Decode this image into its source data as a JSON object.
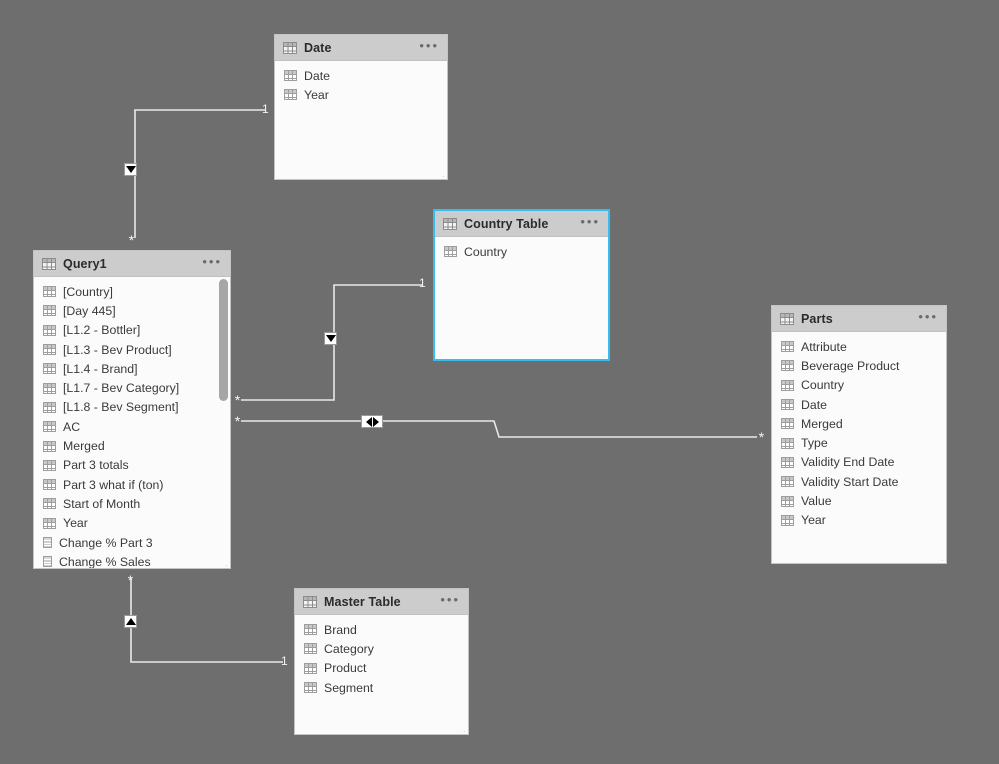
{
  "canvas": {
    "background_color": "#6e6e6e",
    "view_name": "Model view relationships diagram"
  },
  "tables": [
    {
      "id": "date",
      "name": "Date",
      "selected": false,
      "menu_label": "•••",
      "fields": [
        {
          "label": "Date",
          "icon": "table-column-icon",
          "kind": "column"
        },
        {
          "label": "Year",
          "icon": "table-column-icon",
          "kind": "column"
        }
      ]
    },
    {
      "id": "country-table",
      "name": "Country Table",
      "selected": true,
      "menu_label": "•••",
      "fields": [
        {
          "label": "Country",
          "icon": "table-column-icon",
          "kind": "column"
        }
      ]
    },
    {
      "id": "query1",
      "name": "Query1",
      "selected": false,
      "menu_label": "•••",
      "fields": [
        {
          "label": "[Country]",
          "icon": "table-column-icon",
          "kind": "column"
        },
        {
          "label": "[Day 445]",
          "icon": "table-column-icon",
          "kind": "column"
        },
        {
          "label": "[L1.2 - Bottler]",
          "icon": "table-column-icon",
          "kind": "column"
        },
        {
          "label": "[L1.3 - Bev Product]",
          "icon": "table-column-icon",
          "kind": "column"
        },
        {
          "label": "[L1.4 - Brand]",
          "icon": "table-column-icon",
          "kind": "column"
        },
        {
          "label": "[L1.7 - Bev Category]",
          "icon": "table-column-icon",
          "kind": "column"
        },
        {
          "label": "[L1.8 - Bev Segment]",
          "icon": "table-column-icon",
          "kind": "column"
        },
        {
          "label": "AC",
          "icon": "table-column-icon",
          "kind": "column"
        },
        {
          "label": "Merged",
          "icon": "table-column-icon",
          "kind": "column"
        },
        {
          "label": "Part 3 totals",
          "icon": "table-column-icon",
          "kind": "column"
        },
        {
          "label": "Part 3 what if (ton)",
          "icon": "table-column-icon",
          "kind": "column"
        },
        {
          "label": "Start of Month",
          "icon": "table-column-icon",
          "kind": "column"
        },
        {
          "label": "Year",
          "icon": "table-column-icon",
          "kind": "column"
        },
        {
          "label": "Change % Part 3",
          "icon": "measure-icon",
          "kind": "measure"
        },
        {
          "label": "Change % Sales",
          "icon": "measure-icon",
          "kind": "measure"
        }
      ]
    },
    {
      "id": "parts",
      "name": "Parts",
      "selected": false,
      "menu_label": "•••",
      "fields": [
        {
          "label": "Attribute",
          "icon": "table-column-icon",
          "kind": "column"
        },
        {
          "label": "Beverage Product",
          "icon": "table-column-icon",
          "kind": "column"
        },
        {
          "label": "Country",
          "icon": "table-column-icon",
          "kind": "column"
        },
        {
          "label": "Date",
          "icon": "table-column-icon",
          "kind": "column"
        },
        {
          "label": "Merged",
          "icon": "table-column-icon",
          "kind": "column"
        },
        {
          "label": "Type",
          "icon": "table-column-icon",
          "kind": "column"
        },
        {
          "label": "Validity End Date",
          "icon": "table-column-icon",
          "kind": "column"
        },
        {
          "label": "Validity Start Date",
          "icon": "table-column-icon",
          "kind": "column"
        },
        {
          "label": "Value",
          "icon": "table-column-icon",
          "kind": "column"
        },
        {
          "label": "Year",
          "icon": "table-column-icon",
          "kind": "column"
        }
      ]
    },
    {
      "id": "master-table",
      "name": "Master Table",
      "selected": false,
      "menu_label": "•••",
      "fields": [
        {
          "label": "Brand",
          "icon": "table-column-icon",
          "kind": "column"
        },
        {
          "label": "Category",
          "icon": "table-column-icon",
          "kind": "column"
        },
        {
          "label": "Product",
          "icon": "table-column-icon",
          "kind": "column"
        },
        {
          "label": "Segment",
          "icon": "table-column-icon",
          "kind": "column"
        }
      ]
    }
  ],
  "relationships": [
    {
      "id": "date-query1",
      "from_table": "Date",
      "to_table": "Query1",
      "from_cardinality": "1",
      "to_cardinality": "*",
      "cross_filter_direction": "single",
      "arrow_icon": "arrow-down-icon"
    },
    {
      "id": "country-query1",
      "from_table": "Country Table",
      "to_table": "Query1",
      "from_cardinality": "1",
      "to_cardinality": "*",
      "cross_filter_direction": "single",
      "arrow_icon": "arrow-down-icon"
    },
    {
      "id": "query1-parts",
      "from_table": "Query1",
      "to_table": "Parts",
      "from_cardinality": "*",
      "to_cardinality": "*",
      "cross_filter_direction": "both",
      "arrow_icon": "arrow-both-icon"
    },
    {
      "id": "master-query1",
      "from_table": "Master Table",
      "to_table": "Query1",
      "from_cardinality": "1",
      "to_cardinality": "*",
      "cross_filter_direction": "single",
      "arrow_icon": "arrow-up-icon"
    }
  ],
  "colors": {
    "canvas": "#6e6e6e",
    "card_background": "#fbfbfb",
    "card_header": "#cccccc",
    "card_border": "#c4c4c4",
    "selection": "#35bdf2",
    "relationship_line": "#e8e8e8"
  }
}
